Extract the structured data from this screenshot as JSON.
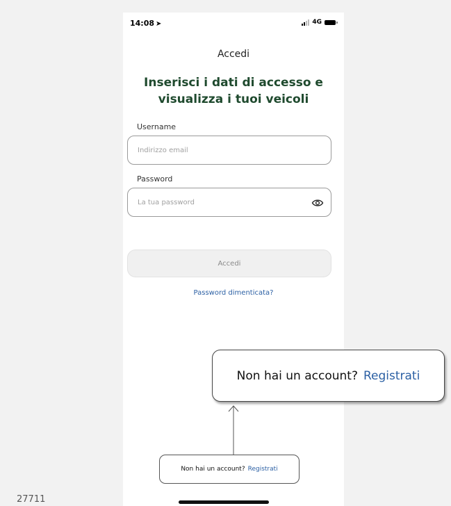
{
  "status_bar": {
    "time": "14:08",
    "network": "4G"
  },
  "nav": {
    "title": "Accedi"
  },
  "heading": {
    "line1": "Inserisci i dati di accesso e",
    "line2": "visualizza i tuoi veicoli"
  },
  "form": {
    "username_label": "Username",
    "username_placeholder": "Indirizzo email",
    "password_label": "Password",
    "password_placeholder": "La tua password",
    "submit_label": "Accedi",
    "forgot_label": "Password dimenticata?"
  },
  "signup": {
    "prompt": "Non hai un account?",
    "link": "Registrati"
  },
  "figure_number": "27711",
  "colors": {
    "heading": "#1f4a2e",
    "link": "#2c60a4"
  },
  "icons": {
    "password_toggle": "eye-icon",
    "location": "location-arrow-icon"
  }
}
